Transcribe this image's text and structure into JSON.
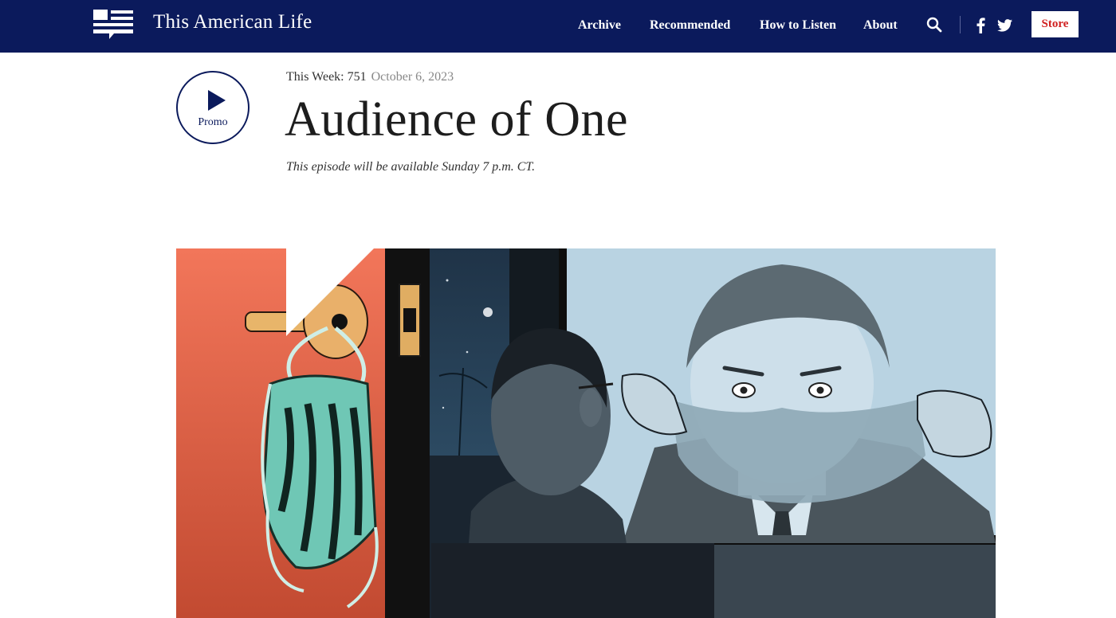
{
  "header": {
    "brand": "This American Life",
    "nav": [
      "Archive",
      "Recommended",
      "How to Listen",
      "About"
    ],
    "store_label": "Store",
    "icons": [
      "search-icon",
      "facebook-icon",
      "twitter-icon"
    ],
    "colors": {
      "navy": "#0b1a5c",
      "store_text": "#d01f1f"
    }
  },
  "episode": {
    "promo_label": "Promo",
    "this_week_label": "This Week:",
    "number": "751",
    "date": "October 6, 2023",
    "title": "Audience of One",
    "availability": "This episode will be available Sunday 7 p.m. CT."
  }
}
